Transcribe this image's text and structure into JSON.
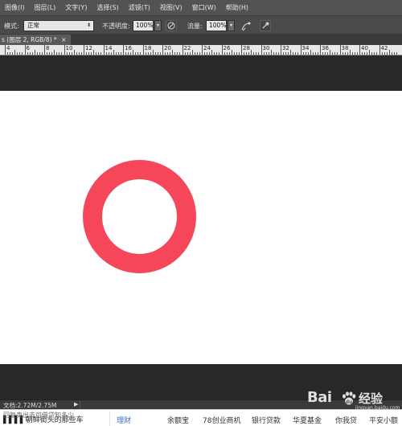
{
  "menu": {
    "items": [
      "图像(I)",
      "图层(L)",
      "文字(Y)",
      "选择(S)",
      "滤镜(T)",
      "视图(V)",
      "窗口(W)",
      "帮助(H)"
    ]
  },
  "options": {
    "mode_label": "模式:",
    "mode_value": "正常",
    "opacity_label": "不透明度:",
    "opacity_value": "100%",
    "flow_label": "流量:",
    "flow_value": "100%",
    "airbrush_icon": "airbrush-icon",
    "pressure_icon": "pen-pressure-icon",
    "brush_settings_icon": "brush-settings-icon"
  },
  "document": {
    "tab_label": "s (图层 2, RGB/8) *",
    "close_glyph": "×"
  },
  "ruler": {
    "labels": [
      "4",
      "6",
      "8",
      "10",
      "12",
      "14",
      "16",
      "18",
      "20",
      "22",
      "24",
      "26",
      "28",
      "30",
      "32",
      "34",
      "36",
      "38",
      "40",
      "42"
    ]
  },
  "canvas": {
    "ring_color": "#f54759",
    "background": "#ffffff"
  },
  "status": {
    "doc_info": "文档:2.72M/2.75M",
    "arrow": "▶"
  },
  "webstrip": {
    "news_top": "回复卖出去可借贷知多少",
    "news": "▌▌▌▌朝鲜街头的那些车",
    "nav": [
      "理财",
      "余额宝",
      "78创业商机",
      "银行贷款",
      "华夏基金",
      "你我贷",
      "平安小额"
    ]
  },
  "watermark": {
    "left": "Bai",
    "right": "经验",
    "url": "jingyan.baidu.com"
  }
}
